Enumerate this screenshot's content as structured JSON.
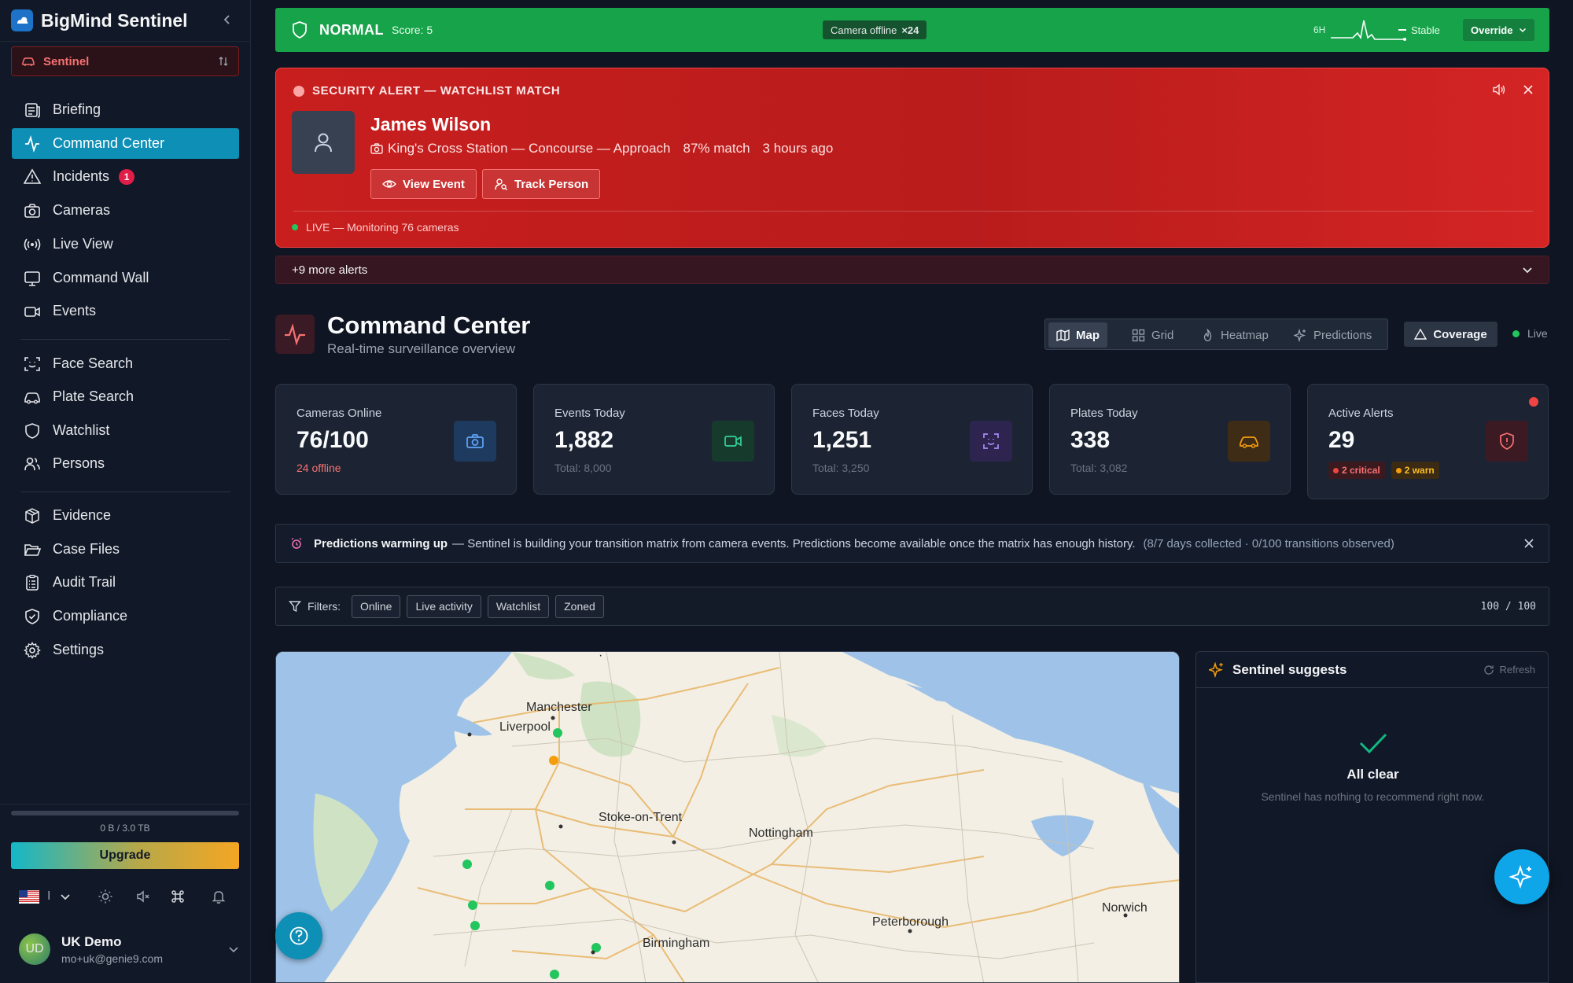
{
  "brand": {
    "name": "BigMind Sentinel"
  },
  "workspace": {
    "label": "Sentinel"
  },
  "nav": {
    "briefing": "Briefing",
    "command_center": "Command Center",
    "incidents": "Incidents",
    "incidents_badge": "1",
    "cameras": "Cameras",
    "live_view": "Live View",
    "command_wall": "Command Wall",
    "events": "Events",
    "face_search": "Face Search",
    "plate_search": "Plate Search",
    "watchlist": "Watchlist",
    "persons": "Persons",
    "evidence": "Evidence",
    "case_files": "Case Files",
    "audit_trail": "Audit Trail",
    "compliance": "Compliance",
    "settings": "Settings"
  },
  "storage": {
    "text": "0 B / 3.0 TB",
    "used_fraction": 0,
    "upgrade_label": "Upgrade"
  },
  "language": {
    "code": "I"
  },
  "user": {
    "initials": "UD",
    "name": "UK Demo",
    "email": "mo+uk@genie9.com"
  },
  "status": {
    "state": "NORMAL",
    "score": "Score: 5",
    "camera_offline_label": "Camera offline",
    "camera_offline_count": "×24",
    "range": "6H",
    "trend": "Stable",
    "override_label": "Override"
  },
  "alert": {
    "title": "SECURITY ALERT — WATCHLIST MATCH",
    "name": "James Wilson",
    "location": "King's Cross Station — Concourse — Approach",
    "match": "87% match",
    "time": "3 hours ago",
    "view_event": "View Event",
    "track_person": "Track Person",
    "live_text": "LIVE — Monitoring 76 cameras",
    "more_alerts": "+9 more alerts"
  },
  "page": {
    "title": "Command Center",
    "subtitle": "Real-time surveillance overview"
  },
  "view_tabs": {
    "map": "Map",
    "grid": "Grid",
    "heatmap": "Heatmap",
    "predictions": "Predictions"
  },
  "coverage_label": "Coverage",
  "live_label": "Live",
  "kpis": {
    "cameras": {
      "label": "Cameras Online",
      "value": "76/100",
      "sub": "24 offline"
    },
    "events": {
      "label": "Events Today",
      "value": "1,882",
      "sub": "Total: 8,000"
    },
    "faces": {
      "label": "Faces Today",
      "value": "1,251",
      "sub": "Total: 3,250"
    },
    "plates": {
      "label": "Plates Today",
      "value": "338",
      "sub": "Total: 3,082"
    },
    "alerts": {
      "label": "Active Alerts",
      "value": "29",
      "critical": "2 critical",
      "warn": "2 warn"
    }
  },
  "predictions_banner": {
    "title": "Predictions warming up",
    "body": "— Sentinel is building your transition matrix from camera events. Predictions become available once the matrix has enough history.",
    "progress": "(8/7 days collected · 0/100 transitions observed)"
  },
  "filters": {
    "label": "Filters:",
    "chips": [
      "Online",
      "Live activity",
      "Watchlist",
      "Zoned"
    ],
    "count": "100 / 100"
  },
  "map": {
    "cities": {
      "manchester": "Manchester",
      "liverpool": "Liverpool",
      "stoke": "Stoke-on-Trent",
      "nottingham": "Nottingham",
      "peterborough": "Peterborough",
      "norwich": "Norwich",
      "birmingham": "Birmingham"
    }
  },
  "suggest": {
    "title": "Sentinel suggests",
    "refresh": "Refresh",
    "heading": "All clear",
    "text": "Sentinel has nothing to recommend right now."
  },
  "colors": {
    "status_normal": "#16a34a",
    "alert_red": "#c81e1e",
    "accent": "#0e8fb5",
    "offline_text": "#f87171"
  }
}
